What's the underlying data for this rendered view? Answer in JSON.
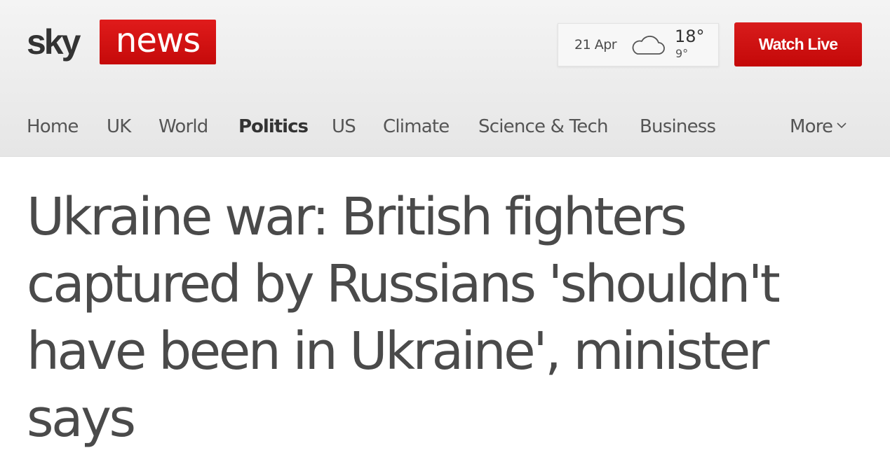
{
  "brand": {
    "logo_sky": "sky",
    "logo_news": "news",
    "colors": {
      "accent_red": "#c90b0b",
      "text_dark": "#4a4a4a"
    }
  },
  "weather": {
    "date": "21 Apr",
    "icon": "cloud-icon",
    "high": "18°",
    "low": "9°"
  },
  "header": {
    "watch_live_label": "Watch Live"
  },
  "nav": {
    "items": [
      {
        "label": "Home",
        "active": false
      },
      {
        "label": "UK",
        "active": false
      },
      {
        "label": "World",
        "active": false
      },
      {
        "label": "Politics",
        "active": true
      },
      {
        "label": "US",
        "active": false
      },
      {
        "label": "Climate",
        "active": false
      },
      {
        "label": "Science & Tech",
        "active": false
      },
      {
        "label": "Business",
        "active": false
      }
    ],
    "more_label": "More"
  },
  "article": {
    "headline": "Ukraine war: British fighters captured by Russians 'shouldn't have been in Ukraine', minister says"
  }
}
